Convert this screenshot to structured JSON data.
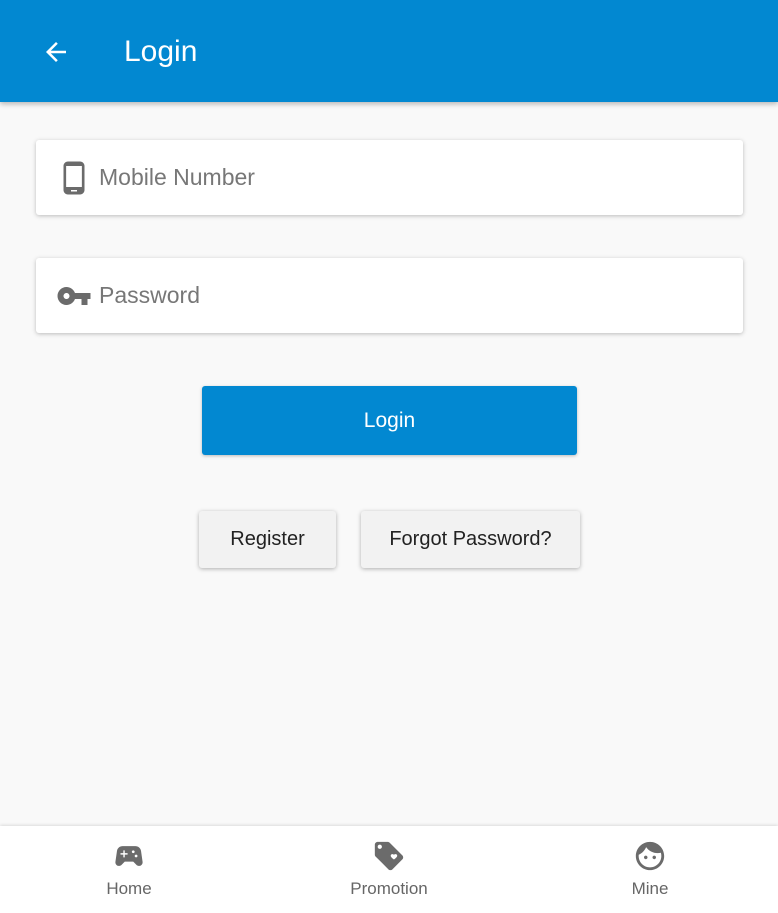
{
  "header": {
    "title": "Login",
    "back_icon": "arrow-left-icon"
  },
  "form": {
    "mobile": {
      "placeholder": "Mobile Number",
      "value": "",
      "icon": "phone-icon"
    },
    "password": {
      "placeholder": "Password",
      "value": "",
      "icon": "key-icon"
    },
    "login_label": "Login",
    "register_label": "Register",
    "forgot_label": "Forgot Password?"
  },
  "nav": {
    "items": [
      {
        "label": "Home",
        "icon": "gamepad-icon"
      },
      {
        "label": "Promotion",
        "icon": "tag-icon"
      },
      {
        "label": "Mine",
        "icon": "face-icon"
      }
    ]
  },
  "colors": {
    "primary": "#0288d1",
    "background": "#f9f9f9",
    "icon_gray": "#6b6b6b"
  }
}
